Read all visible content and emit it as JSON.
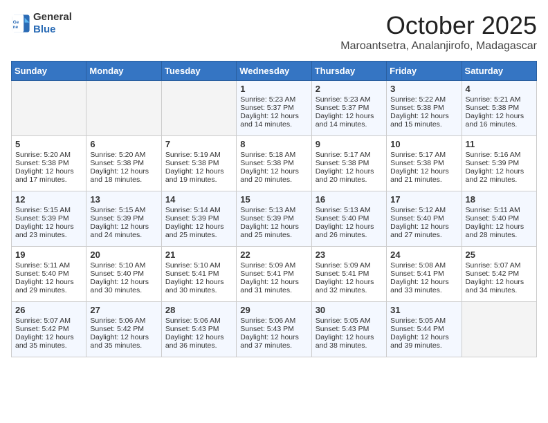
{
  "header": {
    "logo_general": "General",
    "logo_blue": "Blue",
    "month": "October 2025",
    "location": "Maroantsetra, Analanjirofo, Madagascar"
  },
  "days_of_week": [
    "Sunday",
    "Monday",
    "Tuesday",
    "Wednesday",
    "Thursday",
    "Friday",
    "Saturday"
  ],
  "weeks": [
    [
      {
        "day": "",
        "empty": true
      },
      {
        "day": "",
        "empty": true
      },
      {
        "day": "",
        "empty": true
      },
      {
        "day": "1",
        "sunrise": "5:23 AM",
        "sunset": "5:37 PM",
        "daylight": "12 hours and 14 minutes."
      },
      {
        "day": "2",
        "sunrise": "5:23 AM",
        "sunset": "5:37 PM",
        "daylight": "12 hours and 14 minutes."
      },
      {
        "day": "3",
        "sunrise": "5:22 AM",
        "sunset": "5:38 PM",
        "daylight": "12 hours and 15 minutes."
      },
      {
        "day": "4",
        "sunrise": "5:21 AM",
        "sunset": "5:38 PM",
        "daylight": "12 hours and 16 minutes."
      }
    ],
    [
      {
        "day": "5",
        "sunrise": "5:20 AM",
        "sunset": "5:38 PM",
        "daylight": "12 hours and 17 minutes."
      },
      {
        "day": "6",
        "sunrise": "5:20 AM",
        "sunset": "5:38 PM",
        "daylight": "12 hours and 18 minutes."
      },
      {
        "day": "7",
        "sunrise": "5:19 AM",
        "sunset": "5:38 PM",
        "daylight": "12 hours and 19 minutes."
      },
      {
        "day": "8",
        "sunrise": "5:18 AM",
        "sunset": "5:38 PM",
        "daylight": "12 hours and 20 minutes."
      },
      {
        "day": "9",
        "sunrise": "5:17 AM",
        "sunset": "5:38 PM",
        "daylight": "12 hours and 20 minutes."
      },
      {
        "day": "10",
        "sunrise": "5:17 AM",
        "sunset": "5:38 PM",
        "daylight": "12 hours and 21 minutes."
      },
      {
        "day": "11",
        "sunrise": "5:16 AM",
        "sunset": "5:39 PM",
        "daylight": "12 hours and 22 minutes."
      }
    ],
    [
      {
        "day": "12",
        "sunrise": "5:15 AM",
        "sunset": "5:39 PM",
        "daylight": "12 hours and 23 minutes."
      },
      {
        "day": "13",
        "sunrise": "5:15 AM",
        "sunset": "5:39 PM",
        "daylight": "12 hours and 24 minutes."
      },
      {
        "day": "14",
        "sunrise": "5:14 AM",
        "sunset": "5:39 PM",
        "daylight": "12 hours and 25 minutes."
      },
      {
        "day": "15",
        "sunrise": "5:13 AM",
        "sunset": "5:39 PM",
        "daylight": "12 hours and 25 minutes."
      },
      {
        "day": "16",
        "sunrise": "5:13 AM",
        "sunset": "5:40 PM",
        "daylight": "12 hours and 26 minutes."
      },
      {
        "day": "17",
        "sunrise": "5:12 AM",
        "sunset": "5:40 PM",
        "daylight": "12 hours and 27 minutes."
      },
      {
        "day": "18",
        "sunrise": "5:11 AM",
        "sunset": "5:40 PM",
        "daylight": "12 hours and 28 minutes."
      }
    ],
    [
      {
        "day": "19",
        "sunrise": "5:11 AM",
        "sunset": "5:40 PM",
        "daylight": "12 hours and 29 minutes."
      },
      {
        "day": "20",
        "sunrise": "5:10 AM",
        "sunset": "5:40 PM",
        "daylight": "12 hours and 30 minutes."
      },
      {
        "day": "21",
        "sunrise": "5:10 AM",
        "sunset": "5:41 PM",
        "daylight": "12 hours and 30 minutes."
      },
      {
        "day": "22",
        "sunrise": "5:09 AM",
        "sunset": "5:41 PM",
        "daylight": "12 hours and 31 minutes."
      },
      {
        "day": "23",
        "sunrise": "5:09 AM",
        "sunset": "5:41 PM",
        "daylight": "12 hours and 32 minutes."
      },
      {
        "day": "24",
        "sunrise": "5:08 AM",
        "sunset": "5:41 PM",
        "daylight": "12 hours and 33 minutes."
      },
      {
        "day": "25",
        "sunrise": "5:07 AM",
        "sunset": "5:42 PM",
        "daylight": "12 hours and 34 minutes."
      }
    ],
    [
      {
        "day": "26",
        "sunrise": "5:07 AM",
        "sunset": "5:42 PM",
        "daylight": "12 hours and 35 minutes."
      },
      {
        "day": "27",
        "sunrise": "5:06 AM",
        "sunset": "5:42 PM",
        "daylight": "12 hours and 35 minutes."
      },
      {
        "day": "28",
        "sunrise": "5:06 AM",
        "sunset": "5:43 PM",
        "daylight": "12 hours and 36 minutes."
      },
      {
        "day": "29",
        "sunrise": "5:06 AM",
        "sunset": "5:43 PM",
        "daylight": "12 hours and 37 minutes."
      },
      {
        "day": "30",
        "sunrise": "5:05 AM",
        "sunset": "5:43 PM",
        "daylight": "12 hours and 38 minutes."
      },
      {
        "day": "31",
        "sunrise": "5:05 AM",
        "sunset": "5:44 PM",
        "daylight": "12 hours and 39 minutes."
      },
      {
        "day": "",
        "empty": true
      }
    ]
  ],
  "labels": {
    "sunrise": "Sunrise:",
    "sunset": "Sunset:",
    "daylight": "Daylight:"
  }
}
